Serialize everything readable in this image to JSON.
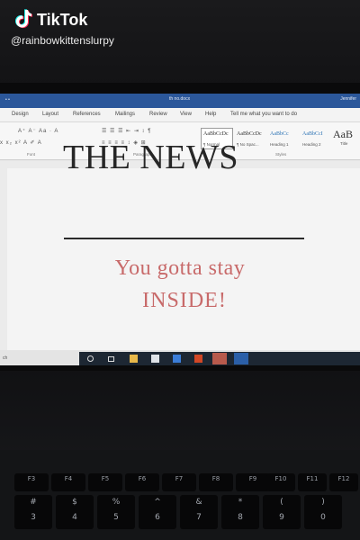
{
  "watermark": {
    "app_name": "TikTok",
    "handle": "@rainbowkittenslurpy",
    "logo_icon": "tiktok-note-icon"
  },
  "word": {
    "window_title": "th no.docx",
    "user_name": "Jennifer",
    "quick_access": "• •",
    "tabs": [
      "Design",
      "Layout",
      "References",
      "Mailings",
      "Review",
      "View",
      "Help",
      "Tell me what you want to do"
    ],
    "group_labels": {
      "font": "Font",
      "paragraph": "Paragraph",
      "styles": "Styles"
    },
    "font_tools_row1": "A⁺  A⁻  Aa ·  A",
    "font_tools_row2": "x  x₂  x²  A  ✐  A",
    "para_tools_row1": "☰  ☰  ☰  ⇤  ⇥  ↕  ¶",
    "para_tools_row2": "≡  ≡  ≡  ≡  ↕  ◈  ⊞",
    "styles": [
      {
        "sample": "AaBbCcDc",
        "name": "¶ Normal",
        "active": true
      },
      {
        "sample": "AaBbCcDc",
        "name": "¶ No Spac...",
        "active": false
      },
      {
        "sample": "AaBbCc",
        "name": "Heading 1",
        "active": false,
        "heading": true
      },
      {
        "sample": "AaBbCcI",
        "name": "Heading 2",
        "active": false,
        "heading": true
      }
    ],
    "style_title_sample": "AaB",
    "style_title_name": "Title",
    "status_text": "ch"
  },
  "document": {
    "headline": "THE NEWS",
    "line1": "You gotta stay",
    "line2": "INSIDE!"
  },
  "colors": {
    "headline": "#262626",
    "body_text": "#c86a6a",
    "titlebar": "#2b579a"
  },
  "keyboard": {
    "function_row": [
      "F3",
      "F4",
      "F5",
      "F6",
      "F7",
      "F8",
      "F9",
      "F10",
      "F11",
      "F12"
    ],
    "number_row_symbols": [
      "#",
      "$",
      "%",
      "^",
      "&",
      "*",
      "(",
      ")"
    ],
    "number_row_digits": [
      "3",
      "4",
      "5",
      "6",
      "7",
      "8",
      "9",
      "0"
    ]
  }
}
